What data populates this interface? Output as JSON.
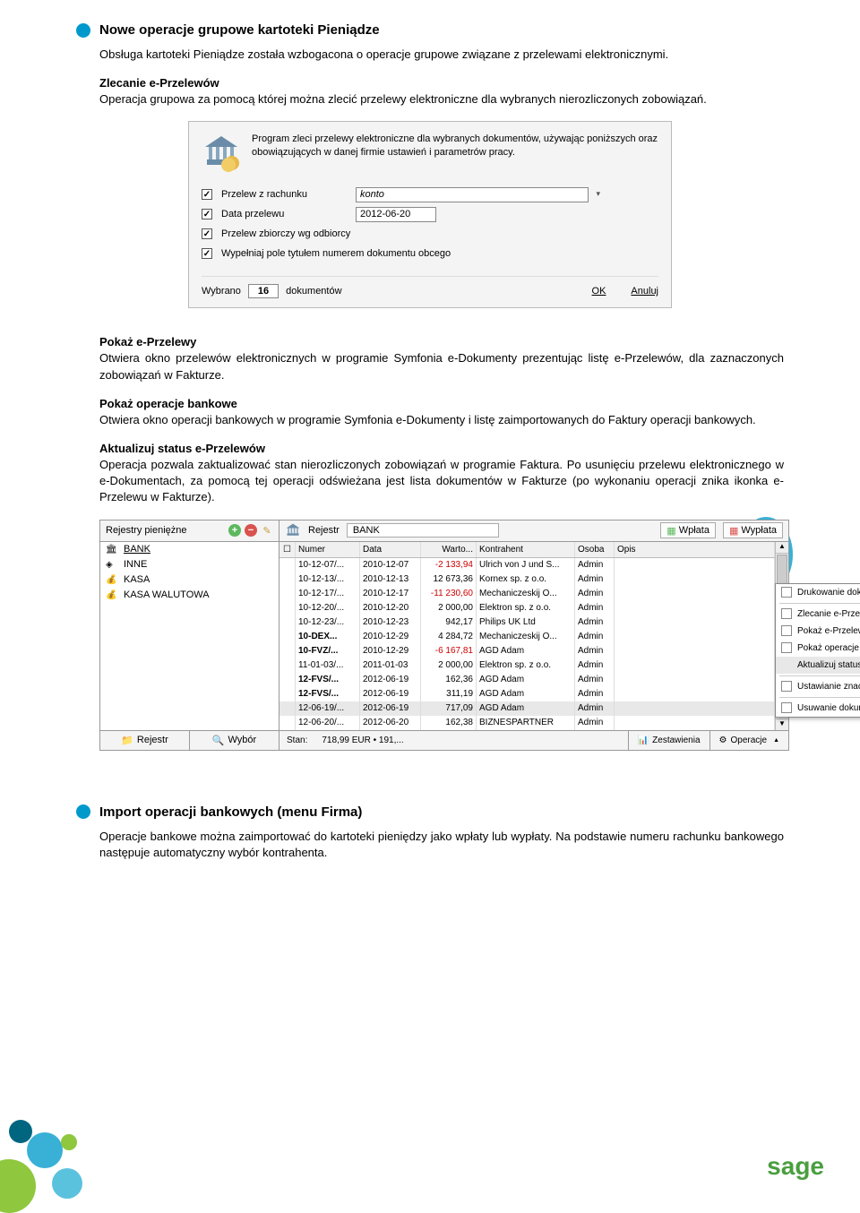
{
  "sec1": {
    "title": "Nowe operacje grupowe kartoteki Pieniądze",
    "intro": "Obsługa kartoteki Pieniądze została wzbogacona o operacje grupowe związane z przelewami elektronicznymi.",
    "sub1_title": "Zlecanie e-Przelewów",
    "sub1_text": "Operacja grupowa za pomocą której można zlecić przelewy elektroniczne dla wybranych nierozliczonych zobowiązań."
  },
  "dialog": {
    "desc": "Program zleci przelewy elektroniczne dla wybranych dokumentów, używając poniższych oraz obowiązujących w danej firmie ustawień i parametrów pracy.",
    "row1_label": "Przelew z rachunku",
    "row1_value": "konto",
    "row2_label": "Data przelewu",
    "row2_value": "2012-06-20",
    "row3_label": "Przelew zbiorczy wg odbiorcy",
    "row4_label": "Wypełniaj pole tytułem numerem dokumentu obcego",
    "foot_wybrano": "Wybrano",
    "foot_count": "16",
    "foot_dok": "dokumentów",
    "btn_ok": "OK",
    "btn_cancel": "Anuluj"
  },
  "sub2_title": "Pokaż e-Przelewy",
  "sub2_text": "Otwiera okno przelewów elektronicznych w programie Symfonia e-Dokumenty prezentując listę e-Przelewów, dla zaznaczonych zobowiązań w Fakturze.",
  "sub3_title": "Pokaż operacje bankowe",
  "sub3_text": "Otwiera okno operacji bankowych w programie Symfonia e-Dokumenty i listę zaimportowanych do Faktury operacji bankowych.",
  "sub4_title": "Aktualizuj status e-Przelewów",
  "sub4_text": "Operacja pozwala zaktualizować stan nierozliczonych zobowiązań w programie Faktura. Po usunięciu przelewu elektronicznego w e-Dokumentach, za pomocą tej operacji odświeżana jest lista dokumentów w Fakturze (po wykonaniu operacji znika ikonka e-Przelewu w Fakturze).",
  "registers": {
    "left_title": "Rejestry pieniężne",
    "items": [
      "BANK",
      "INNE",
      "KASA",
      "KASA WALUTOWA"
    ],
    "left_btn1": "Rejestr",
    "left_btn2": "Wybór",
    "right_lbl": "Rejestr",
    "right_val": "BANK",
    "btn_wplata": "Wpłata",
    "btn_wyplata": "Wypłata",
    "cols": {
      "numer": "Numer",
      "data": "Data",
      "warto": "Warto...",
      "kon": "Kontrahent",
      "osoba": "Osoba",
      "opis": "Opis"
    },
    "rows": [
      {
        "num": "10-12-07/...",
        "date": "2010-12-07",
        "amt": "-2 133,94",
        "neg": true,
        "kon": "Ulrich von J und S...",
        "oso": "Admin"
      },
      {
        "num": "10-12-13/...",
        "date": "2010-12-13",
        "amt": "12 673,36",
        "kon": "Kornex sp. z o.o.",
        "oso": "Admin"
      },
      {
        "num": "10-12-17/...",
        "date": "2010-12-17",
        "amt": "-11 230,60",
        "neg": true,
        "kon": "Mechaniczeskij O...",
        "oso": "Admin"
      },
      {
        "num": "10-12-20/...",
        "date": "2010-12-20",
        "amt": "2 000,00",
        "kon": "Elektron sp. z o.o.",
        "oso": "Admin"
      },
      {
        "num": "10-12-23/...",
        "date": "2010-12-23",
        "amt": "942,17",
        "kon": "Philips UK Ltd",
        "oso": "Admin"
      },
      {
        "num": "10-DEX...",
        "bold": true,
        "date": "2010-12-29",
        "amt": "4 284,72",
        "kon": "Mechaniczeskij O...",
        "oso": "Admin"
      },
      {
        "num": "10-FVZ/...",
        "bold": true,
        "date": "2010-12-29",
        "amt": "-6 167,81",
        "neg": true,
        "kon": "AGD Adam",
        "oso": "Admin"
      },
      {
        "num": "11-01-03/...",
        "date": "2011-01-03",
        "amt": "2 000,00",
        "kon": "Elektron sp. z o.o.",
        "oso": "Admin"
      },
      {
        "num": "12-FVS/...",
        "bold": true,
        "date": "2012-06-19",
        "amt": "162,36",
        "kon": "AGD Adam",
        "oso": "Admin"
      },
      {
        "num": "12-FVS/...",
        "bold": true,
        "date": "2012-06-19",
        "amt": "311,19",
        "kon": "AGD Adam",
        "oso": "Admin"
      },
      {
        "num": "12-06-19/...",
        "date": "2012-06-19",
        "amt": "717,09",
        "kon": "AGD Adam",
        "oso": "Admin",
        "sel": true
      },
      {
        "num": "12-06-20/...",
        "date": "2012-06-20",
        "amt": "162,38",
        "kon": "BIZNESPARTNER",
        "oso": "Admin"
      }
    ],
    "stan_label": "Stan:",
    "stan_value": "718,99 EUR • 191,...",
    "btn_zest": "Zestawienia",
    "btn_oper": "Operacje"
  },
  "ctx": {
    "i1": "Drukowanie dokumentów ...",
    "i2": "Zlecanie e-Przelewów...",
    "i3": "Pokaż e-Przelewy...",
    "i4": "Pokaż operacje bankowe...",
    "i5": "Aktualizuj status e-Przelewów...",
    "i6": "Ustawianie znacznika ...",
    "i7": "Usuwanie dokumentów ..."
  },
  "sec2": {
    "title": "Import operacji bankowych (menu Firma)",
    "text": "Operacje bankowe można zaimportować do kartoteki pieniędzy jako wpłaty lub wypłaty. Na podstawie numeru rachunku bankowego następuje automatyczny wybór kontrahenta."
  },
  "footer_logo": "sage"
}
